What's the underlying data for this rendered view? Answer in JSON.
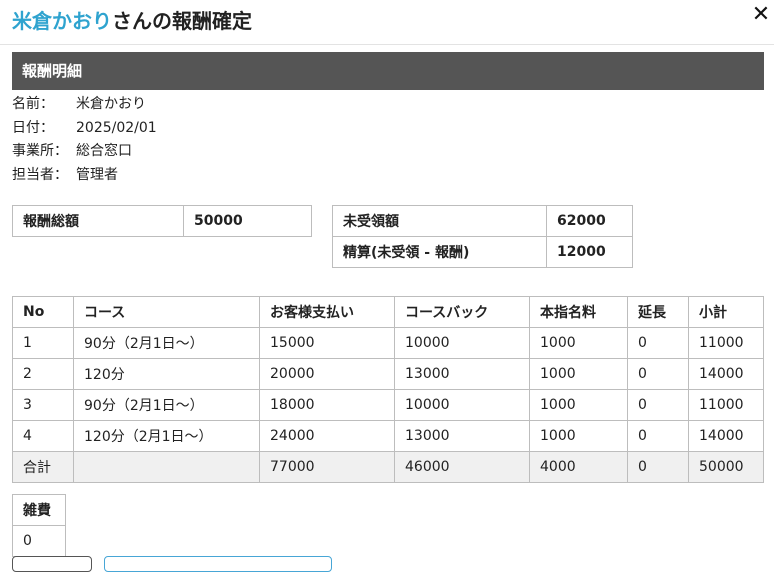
{
  "dialog": {
    "title_name": "米倉かおり",
    "title_suffix": "さんの報酬確定",
    "close_label": "✕"
  },
  "section_title": "報酬明細",
  "info": [
    {
      "label": "名前",
      "sep": "：",
      "value": "米倉かおり"
    },
    {
      "label": "日付",
      "sep": "：",
      "value": "2025/02/01"
    },
    {
      "label": "事業所",
      "sep": "：",
      "value": "総合窓口"
    },
    {
      "label": "担当者",
      "sep": "：",
      "value": "管理者"
    }
  ],
  "summary_left": [
    {
      "label": "報酬総額",
      "value": "50000"
    }
  ],
  "summary_right": [
    {
      "label": "未受領額",
      "value": "62000"
    },
    {
      "label": "精算(未受領 - 報酬)",
      "value": "12000"
    }
  ],
  "detail": {
    "headers": [
      "No",
      "コース",
      "お客様支払い",
      "コースバック",
      "本指名料",
      "延長",
      "小計"
    ],
    "rows": [
      [
        "1",
        "90分（2月1日～）",
        "15000",
        "10000",
        "1000",
        "0",
        "11000"
      ],
      [
        "2",
        "120分",
        "20000",
        "13000",
        "1000",
        "0",
        "14000"
      ],
      [
        "3",
        "90分（2月1日～）",
        "18000",
        "10000",
        "1000",
        "0",
        "11000"
      ],
      [
        "4",
        "120分（2月1日～）",
        "24000",
        "13000",
        "1000",
        "0",
        "14000"
      ]
    ],
    "total": [
      "合計",
      "",
      "77000",
      "46000",
      "4000",
      "0",
      "50000"
    ]
  },
  "misc": {
    "label": "雑費",
    "value": "0"
  },
  "colors": {
    "accent": "#2fa3cf",
    "header_bg": "#555555",
    "total_row_bg": "#f0f0f0"
  }
}
